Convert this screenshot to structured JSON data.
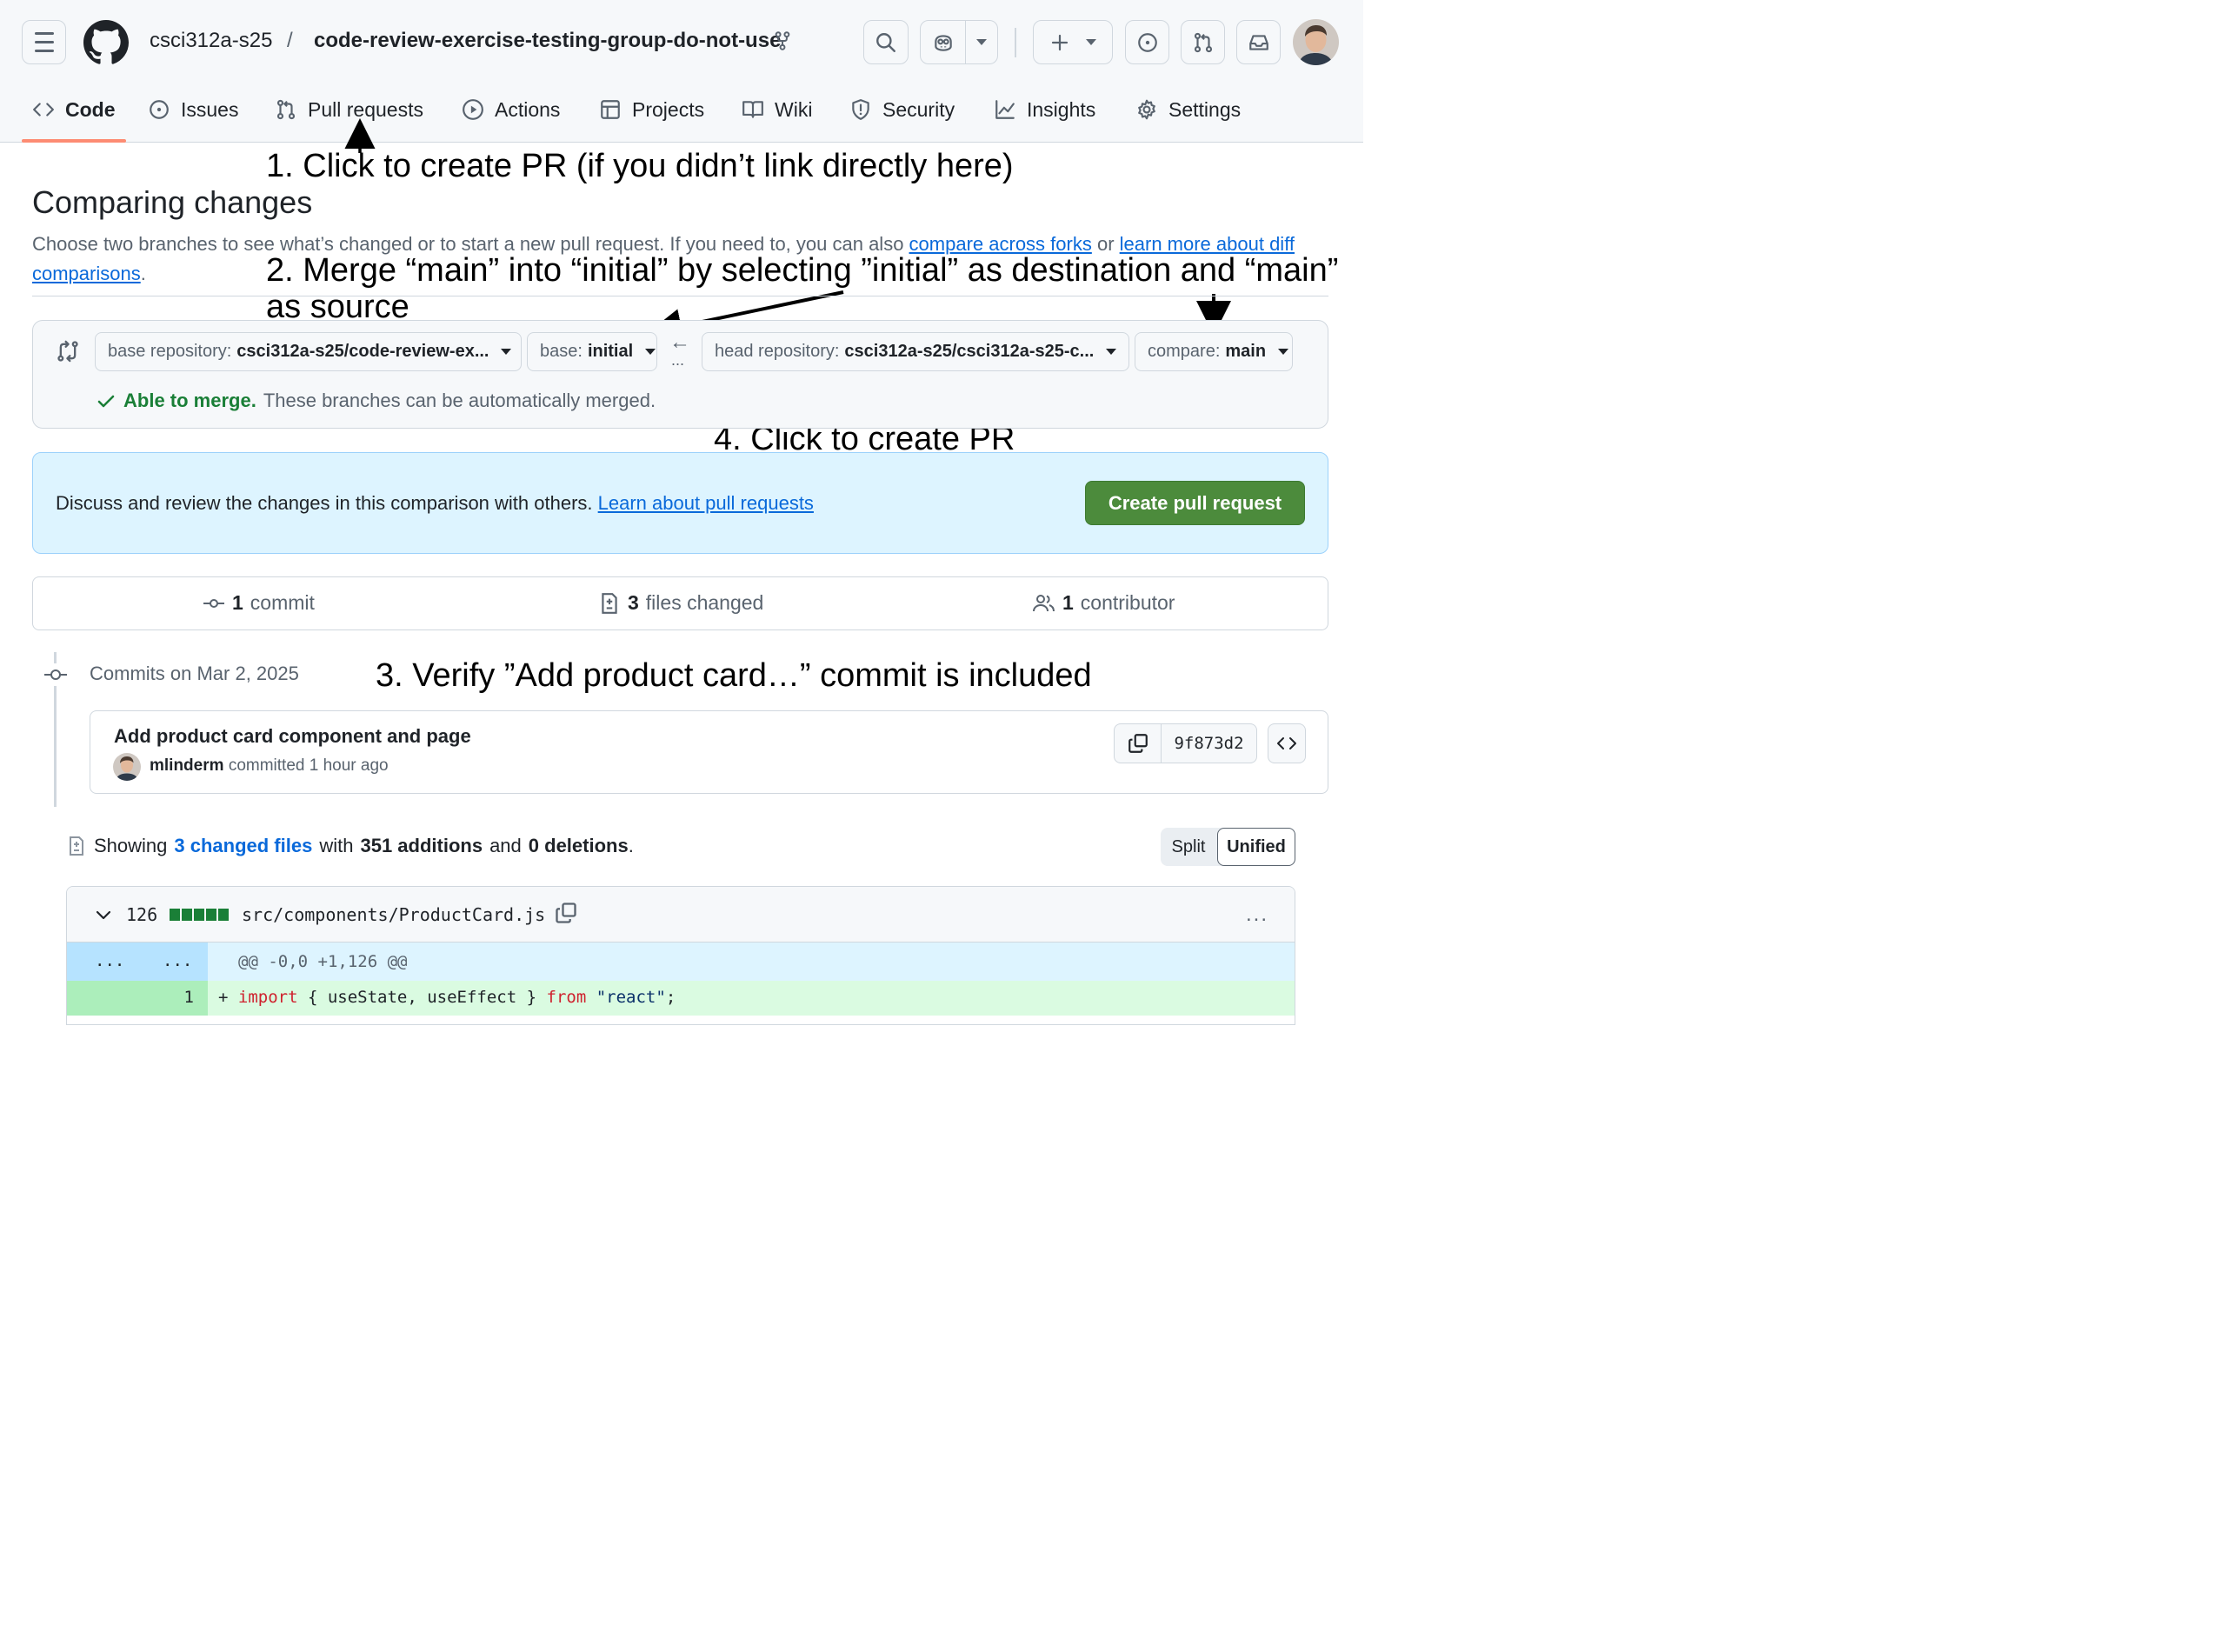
{
  "header": {
    "owner": "csci312a-s25",
    "separator": "/",
    "repo": "code-review-exercise-testing-group-do-not-use"
  },
  "tabs": [
    {
      "label": "Code",
      "icon": "code-icon"
    },
    {
      "label": "Issues",
      "icon": "issue-icon"
    },
    {
      "label": "Pull requests",
      "icon": "pull-request-icon"
    },
    {
      "label": "Actions",
      "icon": "play-icon"
    },
    {
      "label": "Projects",
      "icon": "table-icon"
    },
    {
      "label": "Wiki",
      "icon": "book-icon"
    },
    {
      "label": "Security",
      "icon": "shield-icon"
    },
    {
      "label": "Insights",
      "icon": "graph-icon"
    },
    {
      "label": "Settings",
      "icon": "gear-icon"
    }
  ],
  "annotations": {
    "step1": "1. Click to create PR (if you didn’t link directly here)",
    "step2_line1": "2. Merge “main” into “initial” by selecting ”initial” as destination and “main”",
    "step2_line2": "as source",
    "step3": "3. Verify ”Add product card…” commit is included",
    "step4": "4. Click to create PR"
  },
  "page": {
    "title": "Comparing changes",
    "description_prefix": "Choose two branches to see what’s changed or to start a new pull request. If you need to, you can also ",
    "link_compare_forks": "compare across forks",
    "description_or": " or ",
    "link_learn_more": "learn more about diff comparisons",
    "description_suffix": "."
  },
  "compare": {
    "base_repo_label": "base repository:",
    "base_repo_value": "csci312a-s25/code-review-ex...",
    "base_label": "base:",
    "base_value": "initial",
    "arrow": "←",
    "dots": "...",
    "head_repo_label": "head repository:",
    "head_repo_value": "csci312a-s25/csci312a-s25-c...",
    "compare_label": "compare:",
    "compare_value": "main",
    "merge_status_bold": "Able to merge.",
    "merge_status_text": "These branches can be automatically merged."
  },
  "pr_banner": {
    "text": "Discuss and review the changes in this comparison with others.",
    "link": "Learn about pull requests",
    "button": "Create pull request"
  },
  "stats": {
    "commits_count": "1",
    "commits_label": "commit",
    "files_count": "3",
    "files_label": "files changed",
    "contributors_count": "1",
    "contributors_label": "contributor"
  },
  "commits": {
    "date_label": "Commits on Mar 2, 2025",
    "items": [
      {
        "title": "Add product card component and page",
        "author": "mlinderm",
        "meta": "committed 1 hour ago",
        "sha": "9f873d2"
      }
    ]
  },
  "diff_summary": {
    "showing": "Showing",
    "changed_files": "3 changed files",
    "with": "with",
    "additions": "351 additions",
    "and": "and",
    "deletions": "0 deletions",
    "period": ".",
    "split_label": "Split",
    "unified_label": "Unified"
  },
  "file": {
    "count": "126",
    "path": "src/components/ProductCard.js",
    "more": "...",
    "hunk_left": "...",
    "hunk_right": "...",
    "hunk_header": "@@ -0,0 +1,126 @@",
    "line_number": "1",
    "code_plus": "+ ",
    "code_import": "import",
    "code_mid": " { useState, useEffect } ",
    "code_from": "from",
    "code_space": " ",
    "code_str": "\"react\"",
    "code_end": ";"
  },
  "colors": {
    "accent_underline": "#fd8c73",
    "create_button": "#4c8b3c",
    "link": "#0969da",
    "merge_ok": "#1a7f37",
    "banner_bg": "#ddf4ff"
  }
}
